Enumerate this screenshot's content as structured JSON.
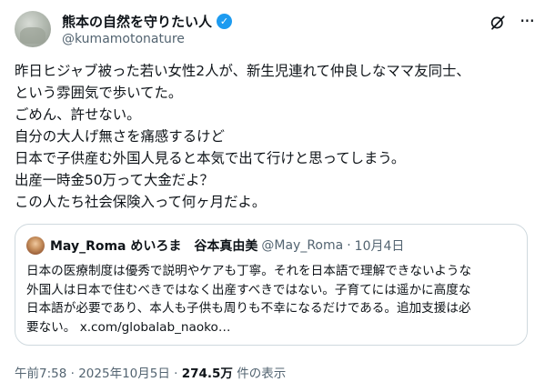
{
  "author": {
    "display_name": "熊本の自然を守りたい人",
    "handle": "@kumamotonature"
  },
  "icons": [
    "verified-badge-icon",
    "grok-icon",
    "more-icon"
  ],
  "tweet_lines": [
    "昨日ヒジャブ被った若い女性2人が、新生児連れて仲良しなママ友同士、",
    "という雰囲気で歩いてた。",
    "ごめん、許せない。",
    "自分の大人げ無さを痛感するけど",
    "日本で子供産む外国人見ると本気で出て行けと思ってしまう。",
    "出産一時金50万って大金だよ？",
    "この人たち社会保険入って何ヶ月だよ。"
  ],
  "quote": {
    "display_name": "May_Roma めいろま　谷本真由美",
    "handle": "@May_Roma",
    "separator": "·",
    "date": "10月4日",
    "lines": [
      "日本の医療制度は優秀で説明やケアも丁寧。それを日本語で理解できないような",
      "外国人は日本で住むべきではなく出産すべきではない。子育てには遥かに高度な",
      "日本語が必要であり、本人も子供も周りも不幸になるだけである。追加支援は必",
      "要ない。 x.com/globalab_naoko…"
    ]
  },
  "meta": {
    "time": "午前7:58",
    "dot": "·",
    "date": "2025年10月5日",
    "views_count": "274.5万",
    "views_label": "件の表示"
  },
  "colors": {
    "accent": "#1d9bf0",
    "text": "#0f1419",
    "secondary": "#536471",
    "border": "#cfd9de"
  }
}
